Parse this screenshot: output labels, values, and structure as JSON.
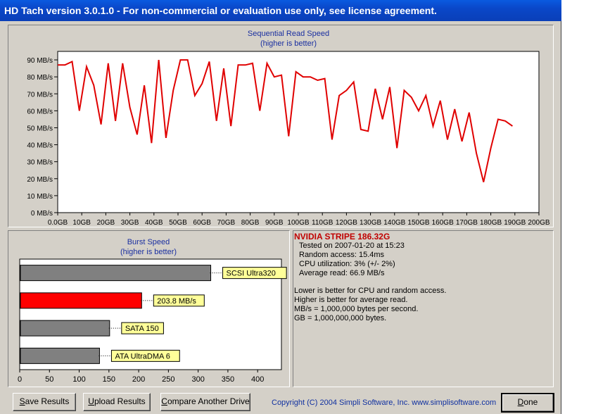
{
  "window": {
    "title": "HD Tach version 3.0.1.0  - For non-commercial or evaluation use only, see license agreement."
  },
  "sequential": {
    "title": "Sequential Read Speed",
    "subtitle": "(higher is better)",
    "y_ticks": [
      "0 MB/s",
      "10 MB/s",
      "20 MB/s",
      "30 MB/s",
      "40 MB/s",
      "50 MB/s",
      "60 MB/s",
      "70 MB/s",
      "80 MB/s",
      "90 MB/s"
    ],
    "x_ticks": [
      "0.0GB",
      "10GB",
      "20GB",
      "30GB",
      "40GB",
      "50GB",
      "60GB",
      "70GB",
      "80GB",
      "90GB",
      "100GB",
      "110GB",
      "120GB",
      "130GB",
      "140GB",
      "150GB",
      "160GB",
      "170GB",
      "180GB",
      "190GB",
      "200GB"
    ],
    "line_color": "#e00000"
  },
  "chart_data": [
    {
      "type": "line",
      "title": "Sequential Read Speed",
      "subtitle": "(higher is better)",
      "xlabel": "",
      "ylabel": "",
      "xlim": [
        0,
        200
      ],
      "ylim": [
        0,
        95
      ],
      "grid": false,
      "x": [
        0,
        3,
        6,
        9,
        12,
        15,
        18,
        21,
        24,
        27,
        30,
        33,
        36,
        39,
        42,
        45,
        48,
        51,
        54,
        57,
        60,
        63,
        66,
        69,
        72,
        75,
        78,
        81,
        84,
        87,
        90,
        93,
        96,
        99,
        102,
        105,
        108,
        111,
        114,
        117,
        120,
        123,
        126,
        129,
        132,
        135,
        138,
        141,
        144,
        147,
        150,
        153,
        156,
        159,
        162,
        165,
        168,
        171,
        174,
        177,
        180,
        183,
        186,
        189,
        192,
        195,
        198,
        200
      ],
      "y": [
        87,
        87,
        89,
        60,
        86,
        75,
        52,
        88,
        54,
        88,
        62,
        46,
        75,
        41,
        90,
        44,
        72,
        90,
        90,
        69,
        76,
        89,
        54,
        85,
        51,
        87,
        87,
        88,
        60,
        88,
        80,
        81,
        45,
        83,
        80,
        80,
        78,
        79,
        43,
        69,
        72,
        77,
        49,
        48,
        73,
        55,
        74,
        38,
        72,
        68,
        60,
        69,
        51,
        66,
        43,
        61,
        42,
        59,
        35,
        18,
        38,
        55,
        54,
        51
      ]
    },
    {
      "type": "bar",
      "title": "Burst Speed",
      "subtitle": "(higher is better)",
      "categories": [
        "SCSI Ultra320",
        "203.8 MB/s",
        "SATA 150",
        "ATA UltraDMA 6"
      ],
      "values": [
        320,
        203.8,
        150,
        133
      ],
      "colors": [
        "#808080",
        "#ff0000",
        "#808080",
        "#808080"
      ],
      "xlim": [
        0,
        440
      ],
      "x_ticks": [
        "0",
        "50",
        "100",
        "150",
        "200",
        "250",
        "300",
        "350",
        "400"
      ]
    }
  ],
  "burst": {
    "title": "Burst Speed",
    "subtitle": "(higher is better)",
    "bars": [
      {
        "label": "SCSI Ultra320",
        "value": 320,
        "color": "#808080"
      },
      {
        "label": "203.8 MB/s",
        "value": 203.8,
        "color": "#ff0000"
      },
      {
        "label": "SATA 150",
        "value": 150,
        "color": "#808080"
      },
      {
        "label": "ATA UltraDMA 6",
        "value": 133,
        "color": "#808080"
      }
    ],
    "x_ticks": [
      "0",
      "50",
      "100",
      "150",
      "200",
      "250",
      "300",
      "350",
      "400"
    ]
  },
  "info": {
    "drive_name": "NVIDIA STRIPE 186.32G",
    "tested_on": "Tested on 2007-01-20 at 15:23",
    "random_access": "Random access: 15.4ms",
    "cpu_utilization": "CPU utilization: 3% (+/- 2%)",
    "average_read": "Average read: 66.9 MB/s",
    "note1": "Lower is better for CPU and random access.",
    "note2": "Higher is better for average read.",
    "note3": "MB/s = 1,000,000 bytes per second.",
    "note4": "GB = 1,000,000,000 bytes."
  },
  "buttons": {
    "save_first": "S",
    "save_rest": "ave Results",
    "upload_first": "U",
    "upload_rest": "pload Results",
    "compare_first": "C",
    "compare_rest": "ompare Another Drive",
    "done_first": "D",
    "done_rest": "one"
  },
  "copyright": "Copyright (C) 2004 Simpli Software, Inc. www.simplisoftware.com"
}
